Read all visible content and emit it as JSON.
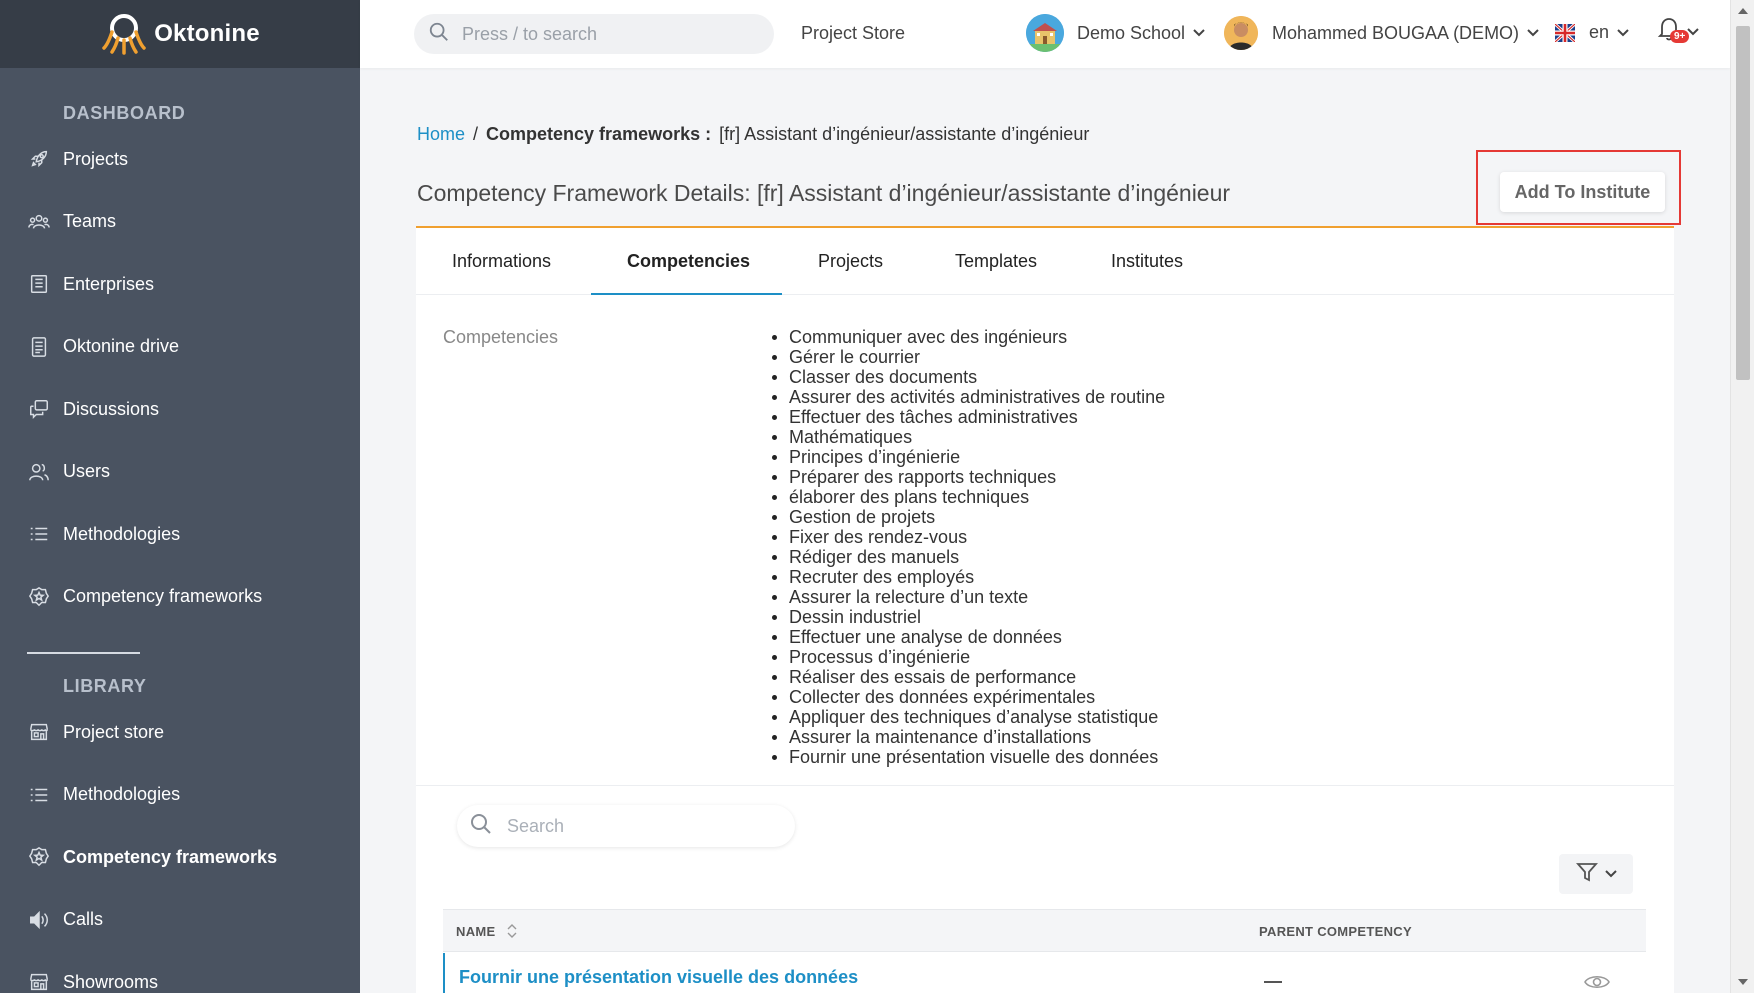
{
  "app": {
    "logo_text": "Oktonine"
  },
  "sidebar": {
    "dashboard_title": "DASHBOARD",
    "dashboard_items": [
      {
        "label": "Projects",
        "icon": "rocket-icon"
      },
      {
        "label": "Teams",
        "icon": "team-icon"
      },
      {
        "label": "Enterprises",
        "icon": "building-icon"
      },
      {
        "label": "Oktonine drive",
        "icon": "drive-icon"
      },
      {
        "label": "Discussions",
        "icon": "chat-icon"
      },
      {
        "label": "Users",
        "icon": "users-icon"
      },
      {
        "label": "Methodologies",
        "icon": "list-icon"
      },
      {
        "label": "Competency frameworks",
        "icon": "badge-icon"
      }
    ],
    "library_title": "LIBRARY",
    "library_items": [
      {
        "label": "Project store",
        "icon": "store-icon"
      },
      {
        "label": "Methodologies",
        "icon": "list-icon"
      },
      {
        "label": "Competency frameworks",
        "icon": "badge-icon",
        "active": true
      },
      {
        "label": "Calls",
        "icon": "speaker-icon"
      },
      {
        "label": "Showrooms",
        "icon": "store-icon"
      }
    ]
  },
  "topbar": {
    "search_placeholder": "Press / to search",
    "project_store": "Project Store",
    "school": "Demo School",
    "user": "Mohammed BOUGAA (DEMO)",
    "language": "en",
    "notification_badge": "9+"
  },
  "breadcrumb": {
    "home": "Home",
    "separator": "/",
    "section": "Competency frameworks :",
    "current": "[fr] Assistant d’ingénieur/assistante d’ingénieur"
  },
  "page": {
    "title": "Competency Framework Details: [fr] Assistant d’ingénieur/assistante d’ingénieur",
    "add_button": "Add To Institute"
  },
  "tabs": [
    {
      "label": "Informations"
    },
    {
      "label": "Competencies",
      "active": true
    },
    {
      "label": "Projects"
    },
    {
      "label": "Templates"
    },
    {
      "label": "Institutes"
    }
  ],
  "competencies": {
    "label": "Competencies",
    "items": [
      "Communiquer avec des ingénieurs",
      "Gérer le courrier",
      "Classer des documents",
      "Assurer des activités administratives de routine",
      "Effectuer des tâches administratives",
      "Mathématiques",
      "Principes d’ingénierie",
      "Préparer des rapports techniques",
      "élaborer des plans techniques",
      "Gestion de projets",
      "Fixer des rendez-vous",
      "Rédiger des manuels",
      "Recruter des employés",
      "Assurer la relecture d’un texte",
      "Dessin industriel",
      "Effectuer une analyse de données",
      "Processus d’ingénierie",
      "Réaliser des essais de performance",
      "Collecter des données expérimentales",
      "Appliquer des techniques d’analyse statistique",
      "Assurer la maintenance d’installations",
      "Fournir une présentation visuelle des données"
    ]
  },
  "table": {
    "search_placeholder": "Search",
    "columns": {
      "name": "NAME",
      "parent": "PARENT COMPETENCY"
    },
    "rows": [
      {
        "name": "Fournir une présentation visuelle des données",
        "parent": "—"
      }
    ]
  },
  "colors": {
    "sidebar_bg": "#4a5361",
    "logo_bg": "#363d47",
    "accent_blue": "#1d8fc6",
    "accent_orange": "#f0a030",
    "highlight_red": "#e53935"
  }
}
